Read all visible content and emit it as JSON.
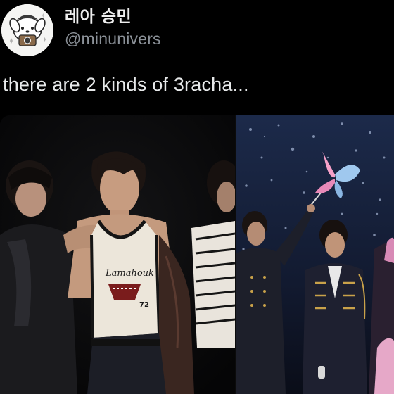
{
  "user": {
    "display_name": "레아 승민",
    "handle": "@minunivers",
    "avatar_icon": "cartoon-dog-with-camera-avatar"
  },
  "tweet": {
    "text": "there are 2 kinds of 3racha..."
  },
  "media": {
    "images": [
      {
        "name": "photoshoot-image",
        "shirt_print": "72"
      },
      {
        "name": "concert-stage-image",
        "prop_icon": "butterfly-wand-icon"
      }
    ]
  },
  "colors": {
    "background": "#000000",
    "text": "#e7e9ea",
    "handle": "#8b9198",
    "butterfly_pink": "#f5a0c8",
    "butterfly_blue": "#9fc8ee"
  }
}
